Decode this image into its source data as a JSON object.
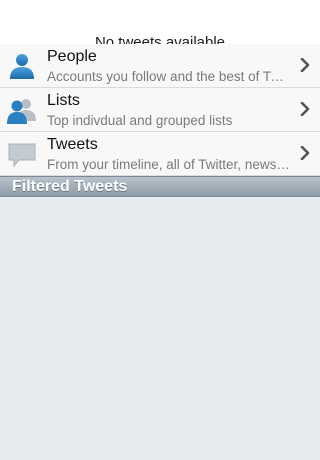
{
  "background": {
    "empty_message": "No tweets available"
  },
  "menu": {
    "items": [
      {
        "title": "People",
        "subtitle": "Accounts you follow and the best of Twitter",
        "icon": "person-icon"
      },
      {
        "title": "Lists",
        "subtitle": "Top indivdual and grouped lists",
        "icon": "people-group-icon"
      },
      {
        "title": "Tweets",
        "subtitle": "From your timeline, all of Twitter, news and more",
        "icon": "speech-bubble-icon"
      }
    ]
  },
  "section": {
    "title": "Filtered Tweets"
  },
  "colors": {
    "accent_blue": "#2a7fc1",
    "header_gradient_top": "#b8c3cc",
    "header_gradient_bottom": "#8f9ba6",
    "content_background": "#e6ebef"
  }
}
